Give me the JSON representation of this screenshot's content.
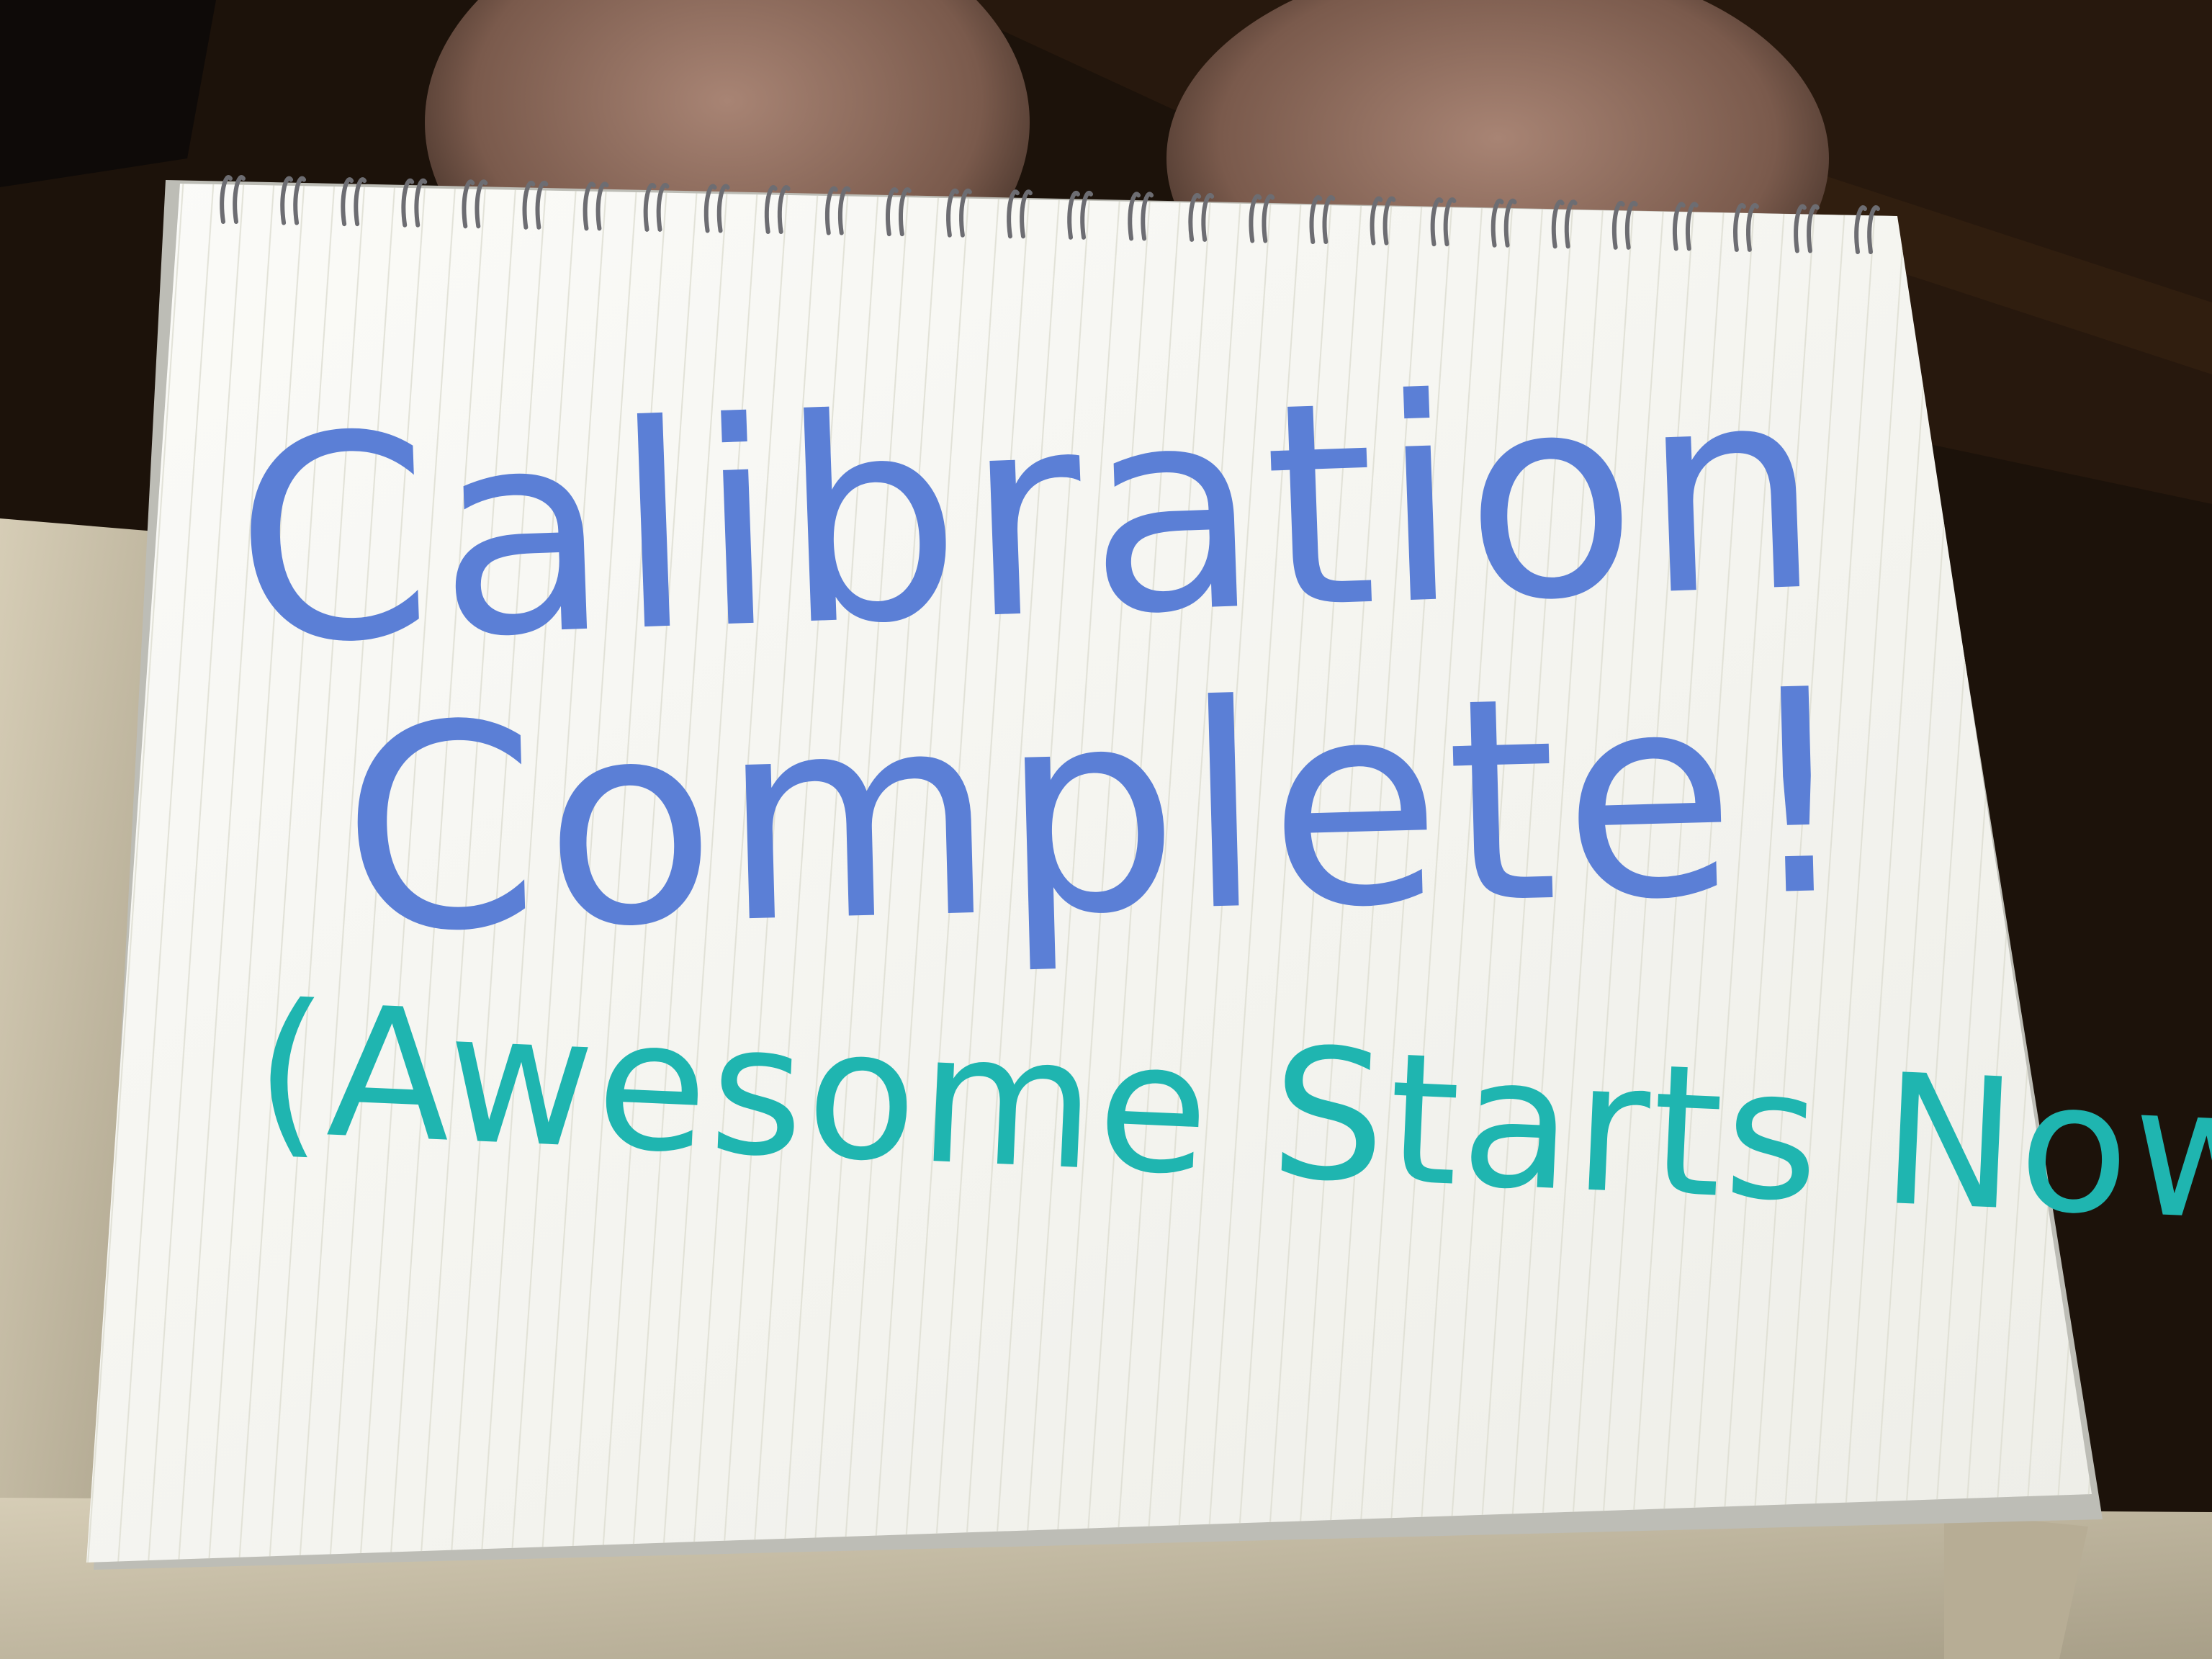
{
  "note": {
    "line1": "Calibration",
    "line2": "Complete!",
    "line3": "(Awesome Starts Now!)"
  },
  "colors": {
    "blue_ink": "#5b7fd6",
    "teal_ink": "#1fb5b0",
    "paper": "#f7f7f3",
    "rule_line": "#dcdcd2",
    "spiral": "#6d6d72",
    "background": "#1a1008",
    "shorts": "#c8bfa8",
    "skin": "#8a6a5a"
  }
}
